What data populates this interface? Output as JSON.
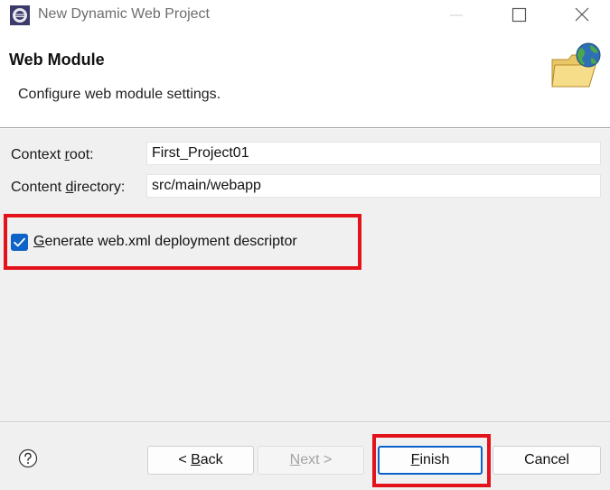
{
  "window": {
    "title": "New Dynamic Web Project"
  },
  "header": {
    "title": "Web Module",
    "description": "Configure web module settings."
  },
  "form": {
    "context_root": {
      "label_pre": "Context ",
      "label_mnemonic": "r",
      "label_post": "oot:",
      "value": "First_Project01"
    },
    "content_directory": {
      "label_pre": "Content ",
      "label_mnemonic": "d",
      "label_post": "irectory:",
      "value": "src/main/webapp"
    },
    "generate_descriptor": {
      "label_mnemonic": "G",
      "label_post": "enerate web.xml deployment descriptor",
      "checked": true
    }
  },
  "buttons": {
    "back": {
      "pre": "< ",
      "mnemonic": "B",
      "post": "ack"
    },
    "next": {
      "mnemonic": "N",
      "post": "ext >"
    },
    "finish": {
      "mnemonic": "F",
      "post": "inish"
    },
    "cancel": {
      "label": "Cancel"
    }
  },
  "colors": {
    "highlight": "#e3121b",
    "accent": "#0d63c8"
  },
  "icons": {
    "app": "eclipse-icon",
    "header": "folder-globe-icon",
    "help": "help-icon"
  }
}
